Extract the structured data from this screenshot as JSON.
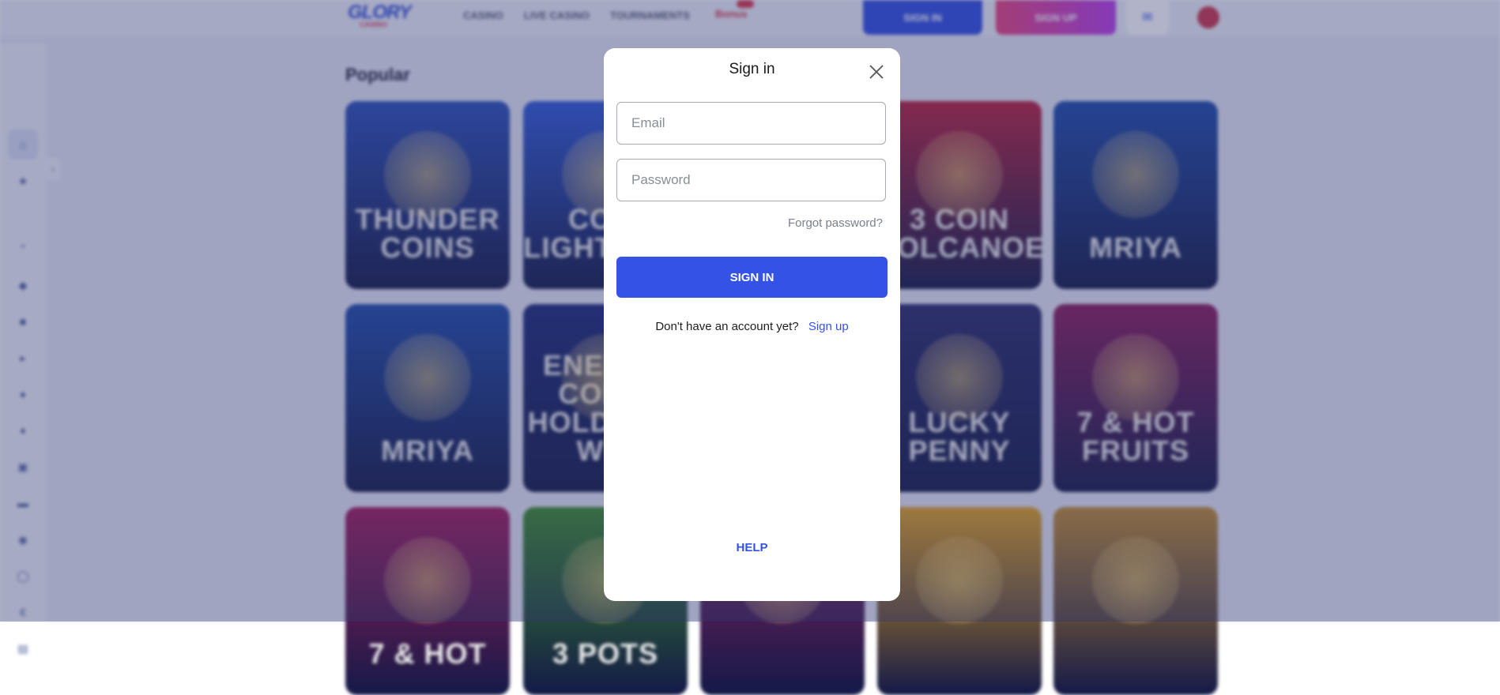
{
  "header": {
    "logo_text": "GLORY",
    "logo_sub": "CASINO",
    "nav": [
      "CASINO",
      "LIVE CASINO",
      "TOURNAMENTS"
    ],
    "nav_highlight": "Bonus",
    "sign_in": "SIGN IN",
    "sign_up": "SIGN UP"
  },
  "page": {
    "section_title": "Popular",
    "games": [
      {
        "name": "THUNDER COINS",
        "color": "#2b4fb8"
      },
      {
        "name": "COIN LIGHTNING",
        "color": "#2f5ad6"
      },
      {
        "name": "",
        "color": "#2a3a8a"
      },
      {
        "name": "3 COIN VOLCANOES",
        "color": "#b8203a"
      },
      {
        "name": "MRIYA",
        "color": "#1f4aa8"
      },
      {
        "name": "MRIYA",
        "color": "#1f4aa8"
      },
      {
        "name": "ENERGY COINS HOLD AND WIN",
        "color": "#1c2a78"
      },
      {
        "name": "",
        "color": "#3a2a7a"
      },
      {
        "name": "LUCKY PENNY",
        "color": "#2a2a6a"
      },
      {
        "name": "7 & HOT FRUITS",
        "color": "#8a1a5a"
      },
      {
        "name": "7 & HOT",
        "color": "#a01a5a"
      },
      {
        "name": "3 POTS",
        "color": "#3a8a2a"
      },
      {
        "name": "",
        "color": "#8a2060"
      },
      {
        "name": "",
        "color": "#e0a020"
      },
      {
        "name": "",
        "color": "#c08a30"
      }
    ]
  },
  "modal": {
    "title": "Sign in",
    "email_placeholder": "Email",
    "password_placeholder": "Password",
    "forgot": "Forgot password?",
    "submit": "SIGN IN",
    "no_account": "Don't have an account yet?",
    "signup_link": "Sign up",
    "help": "HELP"
  },
  "colors": {
    "primary": "#3552e6",
    "overlay": "#323a6e"
  }
}
